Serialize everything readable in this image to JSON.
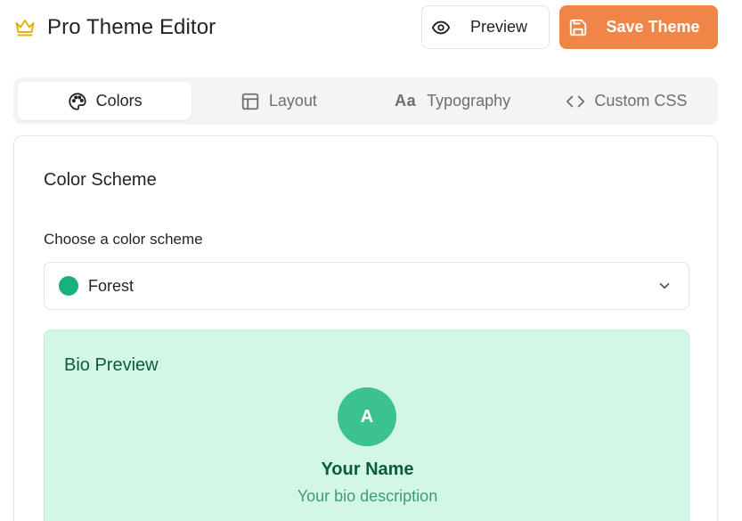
{
  "header": {
    "title": "Pro Theme Editor",
    "icon": "crown-icon",
    "preview_label": "Preview",
    "save_label": "Save Theme"
  },
  "tabs": [
    {
      "label": "Colors",
      "icon": "palette-icon",
      "active": true
    },
    {
      "label": "Layout",
      "icon": "layout-icon",
      "active": false
    },
    {
      "label": "Typography",
      "icon_text": "Aa",
      "active": false
    },
    {
      "label": "Custom CSS",
      "icon": "code-icon",
      "active": false
    }
  ],
  "colors_panel": {
    "section_title": "Color Scheme",
    "field_label": "Choose a color scheme",
    "selected_scheme": "Forest",
    "swatch_color": "#17b07f",
    "preview": {
      "title": "Bio Preview",
      "avatar_initial": "A",
      "name": "Your Name",
      "bio": "Your bio description"
    }
  },
  "colors": {
    "accent": "#f08548",
    "crown": "#e4b20c",
    "preview_bg": "#d2f8e5",
    "preview_text": "#0b5a43"
  }
}
